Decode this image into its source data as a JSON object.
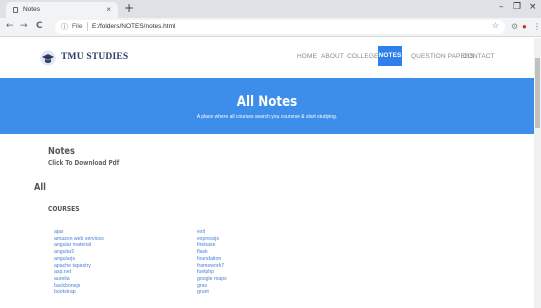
{
  "browser": {
    "tab_title": "Notes",
    "tab_close": "×",
    "new_tab": "+",
    "window_controls": [
      "–",
      "❐",
      "×"
    ],
    "nav_back": "←",
    "nav_forward": "→",
    "nav_reload": "C",
    "info_glyph": "ⓘ",
    "file_label": "File",
    "url": "E:/folders/NOTES/notes.html",
    "star": "☆",
    "menu": "⋮"
  },
  "site": {
    "brand": "TMU STUDIES",
    "nav": [
      "HOME",
      "ABOUT",
      "COLLEGES",
      "NOTES",
      "QUESTION PAPERS",
      "CONTACT"
    ],
    "active_nav": "NOTES",
    "hero_title": "All Notes",
    "hero_subtitle": "A place where all courses search you coursrse & start studying.",
    "notes_title": "Notes",
    "notes_subtitle": "Click To Download Pdf",
    "all_heading": "All",
    "courses_heading": "COURSES",
    "courses_left": [
      "ajax",
      "amazon web services",
      "angular material",
      "angular2",
      "angularjs",
      "apache tapestry",
      "asp.net",
      "aurelia",
      "backbonejs",
      "bootstrap"
    ],
    "courses_right": [
      "exit",
      "expressjs",
      "firebase",
      "flask",
      "foundation",
      "framework7",
      "fuelphp",
      "google maps",
      "grav",
      "grunt"
    ]
  },
  "colors": {
    "accent": "#2f80ed",
    "hero_bg": "#3d8eea",
    "link": "#4a7fd4"
  }
}
